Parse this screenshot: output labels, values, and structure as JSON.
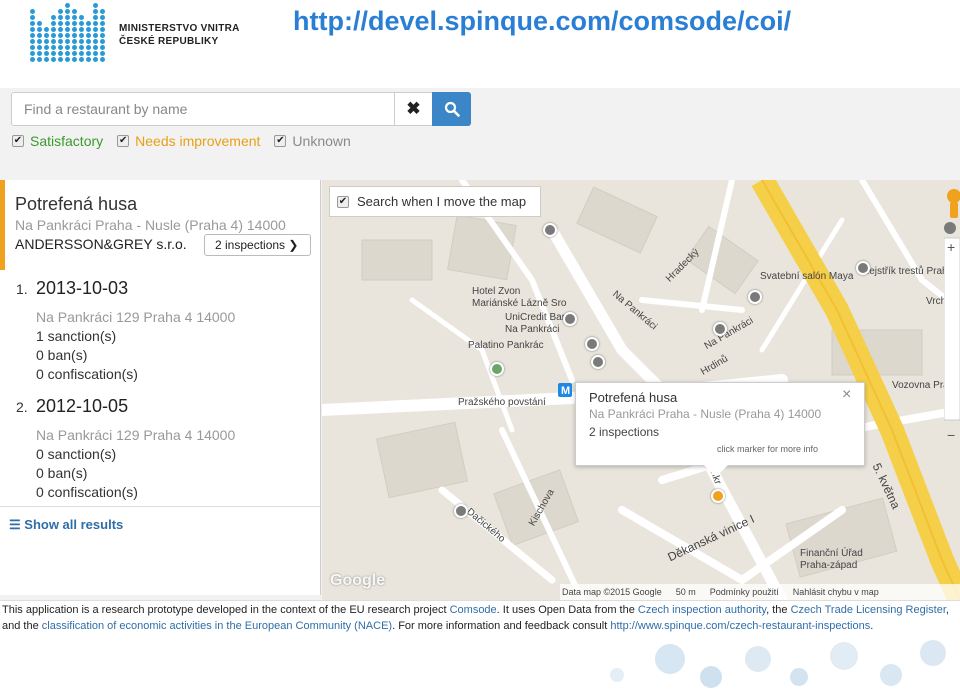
{
  "slide": {
    "logo_text_line1": "MINISTERSTVO VNITRA",
    "logo_text_line2": "ČESKÉ REPUBLIKY",
    "url": "http://devel.spinque.com/comsode/coi/"
  },
  "search": {
    "placeholder": "Find a restaurant by name",
    "clear_icon": "✖",
    "search_icon": "search-icon"
  },
  "filters": [
    {
      "label": "Satisfactory",
      "checked": true,
      "color": "#3a9a2b"
    },
    {
      "label": "Needs improvement",
      "checked": true,
      "color": "#e8a015"
    },
    {
      "label": "Unknown",
      "checked": true,
      "color": "#8a8a8a"
    }
  ],
  "restaurant": {
    "name": "Potrefená husa",
    "address": "Na Pankráci Praha - Nusle (Praha 4) 14000",
    "owner": "ANDERSSON&GREY s.r.o.",
    "inspections_button": "2 inspections ❯",
    "inspections": [
      {
        "num": "1.",
        "date": "2013-10-03",
        "address": "Na Pankráci 129 Praha 4 14000",
        "sanctions": "1 sanction(s)",
        "bans": "0 ban(s)",
        "confiscations": "0 confiscation(s)"
      },
      {
        "num": "2.",
        "date": "2012-10-05",
        "address": "Na Pankráci 129 Praha 4 14000",
        "sanctions": "0 sanction(s)",
        "bans": "0 ban(s)",
        "confiscations": "0 confiscation(s)"
      }
    ]
  },
  "show_all": "Show all results",
  "map": {
    "move_search_label": "Search when I move the map",
    "pois": [
      "Hotel Zvon\nMariánské Lázně Sro",
      "UniCredit Bank\nNa Pankráci",
      "Palatino Pankrác",
      "Pražského povstání",
      "Svatební salón Maya",
      "Rejstřík trestů Praha",
      "Vrchní",
      "Vozovna Pra",
      "Finanční Úřad\nPraha-západ"
    ],
    "streets": [
      "Na Pankráci",
      "Hradecký",
      "Na Pankráci",
      "Hrdinů",
      "Kischova",
      "Dačického",
      "Děkanská vinice I",
      "5. května",
      "Pankr"
    ],
    "popup": {
      "title": "Potrefená husa",
      "address": "Na Pankráci Praha - Nusle (Praha 4) 14000",
      "inspections": "2 inspections",
      "hint": "click marker for more info",
      "close": "×"
    },
    "attribution": [
      "Data map ©2015 Google",
      "50 m",
      "Podmínky použití",
      "Nahlásit chybu v map"
    ],
    "google_logo": "Google",
    "marker_colors": {
      "satisfactory": "#6aa56c",
      "needs_improvement": "#f0a21e",
      "unknown": "#7a7a7a"
    }
  },
  "footer": {
    "part1": "This application is a research prototype developed in the context of the EU research project ",
    "link1": "Comsode",
    "part2": ". It uses Open Data from the ",
    "link2": "Czech inspection authority",
    "part3": ", the ",
    "link3": "Czech Trade Licensing Register",
    "part4": ", and the ",
    "link4": "classification of economic activities in the European Community (NACE)",
    "part5": ". For more information and feedback consult ",
    "link5": "http://www.spinque.com/czech-restaurant-inspections",
    "part6": "."
  }
}
